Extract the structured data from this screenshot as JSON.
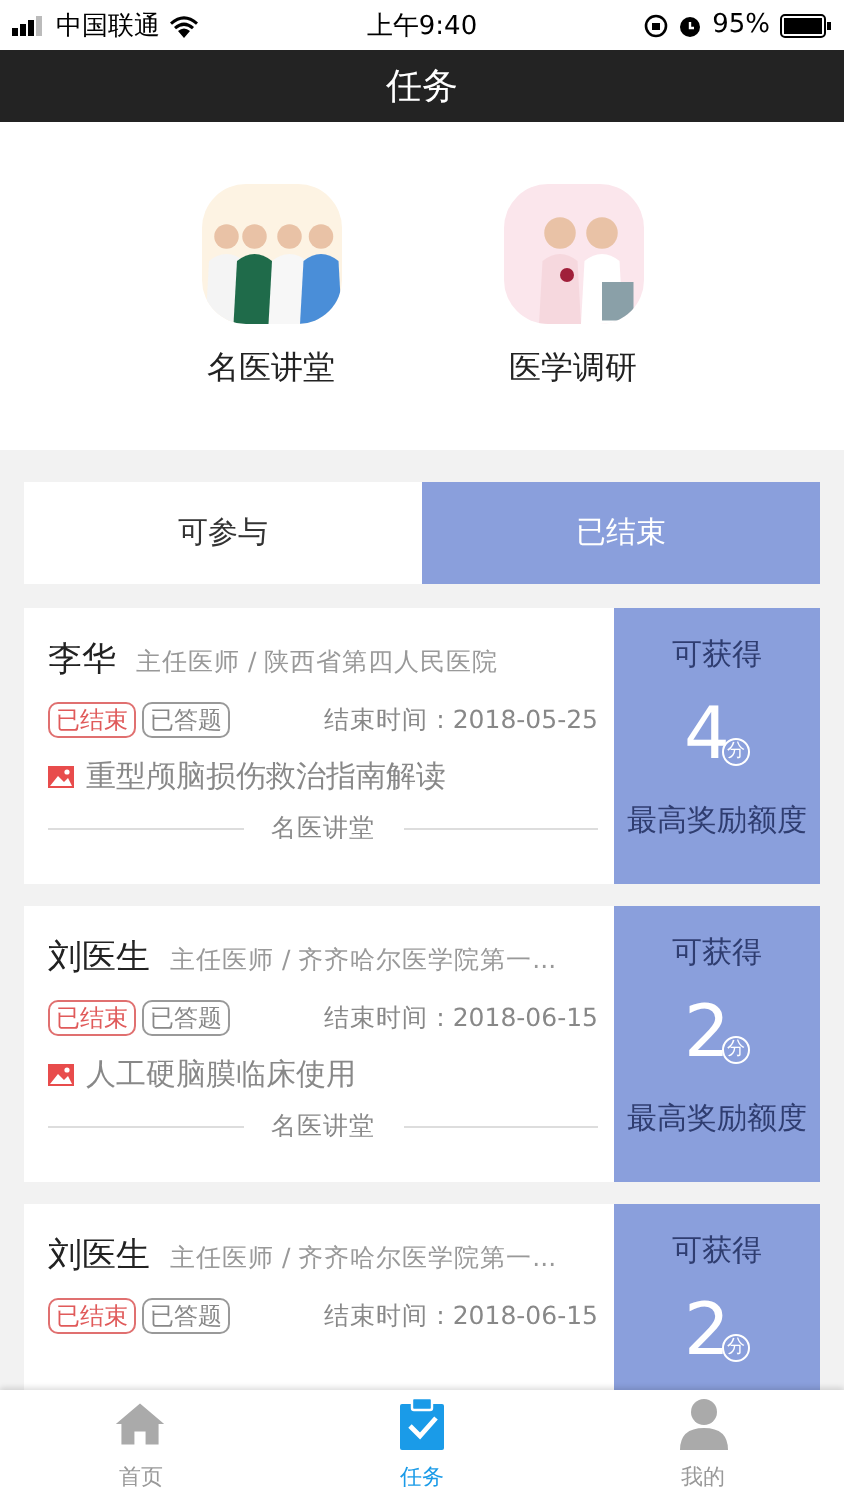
{
  "status_bar": {
    "carrier": "中国联通",
    "time": "上午9:40",
    "battery": "95%"
  },
  "nav": {
    "title": "任务"
  },
  "categories": [
    {
      "label": "名医讲堂",
      "kind": "picture"
    },
    {
      "label": "医学调研",
      "kind": "picture"
    }
  ],
  "tabs": [
    {
      "label": "可参与",
      "selected": false
    },
    {
      "label": "已结束",
      "selected": true
    }
  ],
  "tasks": [
    {
      "name": "李华",
      "title": "主任医师 / 陕西省第四人民医院",
      "tags": [
        {
          "label": "已结束",
          "kind": "ended"
        },
        {
          "label": "已答题",
          "kind": "answered"
        }
      ],
      "end_time": "结束时间 : 2018-05-25",
      "course": "重型颅脑损伤救治指南解读",
      "source": "名医讲堂",
      "reward_label": "可获得",
      "points": "4",
      "unit": "分",
      "reward_note": "最高奖励额度"
    },
    {
      "name": "刘医生",
      "title": "主任医师 / 齐齐哈尔医学院第一...",
      "tags": [
        {
          "label": "已结束",
          "kind": "ended"
        },
        {
          "label": "已答题",
          "kind": "answered"
        }
      ],
      "end_time": "结束时间 : 2018-06-15",
      "course": "人工硬脑膜临床使用",
      "source": "名医讲堂",
      "reward_label": "可获得",
      "points": "2",
      "unit": "分",
      "reward_note": "最高奖励额度"
    },
    {
      "name": "刘医生",
      "title": "主任医师 / 齐齐哈尔医学院第一...",
      "tags": [
        {
          "label": "已结束",
          "kind": "ended"
        },
        {
          "label": "已答题",
          "kind": "answered"
        }
      ],
      "end_time": "结束时间 : 2018-06-15",
      "reward_label": "可获得",
      "points": "2",
      "unit": "分"
    }
  ],
  "tab_bar": [
    {
      "label": "首页",
      "kind": "home",
      "selected": false
    },
    {
      "label": "任务",
      "kind": "tasks",
      "selected": true
    },
    {
      "label": "我的",
      "kind": "profile",
      "selected": false
    }
  ]
}
